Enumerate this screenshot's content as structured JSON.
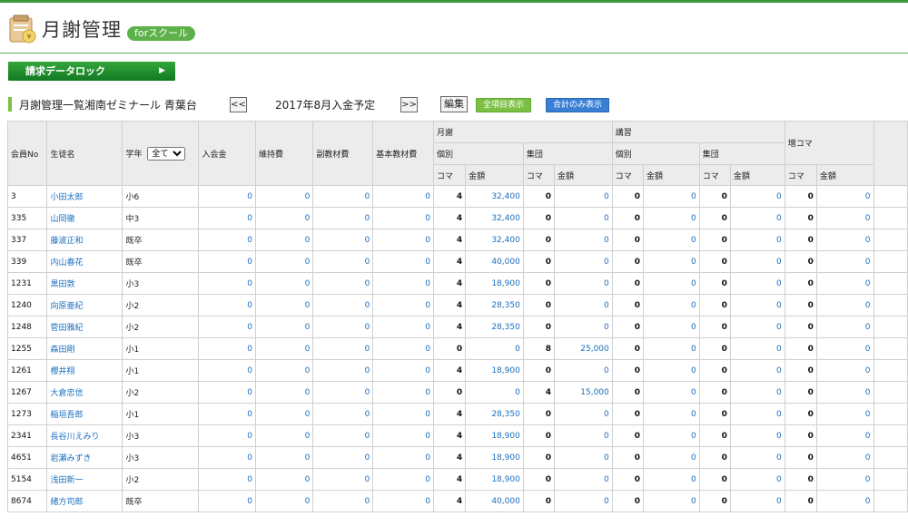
{
  "header": {
    "app_title": "月謝管理",
    "badge": "forスクール",
    "lock_button": "請求データロック",
    "lock_arrow": "▶"
  },
  "toolbar": {
    "title": "月謝管理一覧湘南ゼミナール 青葉台",
    "prev": "<<",
    "month": "2017年8月入金予定",
    "next": ">>",
    "edit": "編集",
    "show_all": "全項目表示",
    "show_total": "合計のみ表示"
  },
  "columns": {
    "member_no": "会員No",
    "name": "生徒名",
    "grade": "学年",
    "grade_select": "全て",
    "admission": "入会金",
    "maintenance": "維持費",
    "sub_material": "副教材費",
    "base_material": "基本教材費",
    "tuition": "月謝",
    "course": "講習",
    "extra": "増コマ",
    "individual": "個別",
    "group": "集団",
    "koma": "コマ",
    "amount": "金額"
  },
  "rows": [
    {
      "id": "3",
      "name": "小田太郎",
      "grade": "小6",
      "adm": "0",
      "mnt": "0",
      "sub": "0",
      "base": "0",
      "ik": "4",
      "ia": "32,400",
      "gk": "0",
      "ga": "0",
      "cik": "0",
      "cia": "0",
      "cgk": "0",
      "cga": "0",
      "ek": "0",
      "ea": "0"
    },
    {
      "id": "335",
      "name": "山岡徹",
      "grade": "中3",
      "adm": "0",
      "mnt": "0",
      "sub": "0",
      "base": "0",
      "ik": "4",
      "ia": "32,400",
      "gk": "0",
      "ga": "0",
      "cik": "0",
      "cia": "0",
      "cgk": "0",
      "cga": "0",
      "ek": "0",
      "ea": "0"
    },
    {
      "id": "337",
      "name": "藤波正和",
      "grade": "既卒",
      "adm": "0",
      "mnt": "0",
      "sub": "0",
      "base": "0",
      "ik": "4",
      "ia": "32,400",
      "gk": "0",
      "ga": "0",
      "cik": "0",
      "cia": "0",
      "cgk": "0",
      "cga": "0",
      "ek": "0",
      "ea": "0"
    },
    {
      "id": "339",
      "name": "内山春花",
      "grade": "既卒",
      "adm": "0",
      "mnt": "0",
      "sub": "0",
      "base": "0",
      "ik": "4",
      "ia": "40,000",
      "gk": "0",
      "ga": "0",
      "cik": "0",
      "cia": "0",
      "cgk": "0",
      "cga": "0",
      "ek": "0",
      "ea": "0"
    },
    {
      "id": "1231",
      "name": "黒田敦",
      "grade": "小3",
      "adm": "0",
      "mnt": "0",
      "sub": "0",
      "base": "0",
      "ik": "4",
      "ia": "18,900",
      "gk": "0",
      "ga": "0",
      "cik": "0",
      "cia": "0",
      "cgk": "0",
      "cga": "0",
      "ek": "0",
      "ea": "0"
    },
    {
      "id": "1240",
      "name": "向原亜紀",
      "grade": "小2",
      "adm": "0",
      "mnt": "0",
      "sub": "0",
      "base": "0",
      "ik": "4",
      "ia": "28,350",
      "gk": "0",
      "ga": "0",
      "cik": "0",
      "cia": "0",
      "cgk": "0",
      "cga": "0",
      "ek": "0",
      "ea": "0"
    },
    {
      "id": "1248",
      "name": "菅田雅紀",
      "grade": "小2",
      "adm": "0",
      "mnt": "0",
      "sub": "0",
      "base": "0",
      "ik": "4",
      "ia": "28,350",
      "gk": "0",
      "ga": "0",
      "cik": "0",
      "cia": "0",
      "cgk": "0",
      "cga": "0",
      "ek": "0",
      "ea": "0"
    },
    {
      "id": "1255",
      "name": "森田剛",
      "grade": "小1",
      "adm": "0",
      "mnt": "0",
      "sub": "0",
      "base": "0",
      "ik": "0",
      "ia": "0",
      "gk": "8",
      "ga": "25,000",
      "cik": "0",
      "cia": "0",
      "cgk": "0",
      "cga": "0",
      "ek": "0",
      "ea": "0"
    },
    {
      "id": "1261",
      "name": "櫻井翔",
      "grade": "小1",
      "adm": "0",
      "mnt": "0",
      "sub": "0",
      "base": "0",
      "ik": "4",
      "ia": "18,900",
      "gk": "0",
      "ga": "0",
      "cik": "0",
      "cia": "0",
      "cgk": "0",
      "cga": "0",
      "ek": "0",
      "ea": "0"
    },
    {
      "id": "1267",
      "name": "大倉忠信",
      "grade": "小2",
      "adm": "0",
      "mnt": "0",
      "sub": "0",
      "base": "0",
      "ik": "0",
      "ia": "0",
      "gk": "4",
      "ga": "15,000",
      "cik": "0",
      "cia": "0",
      "cgk": "0",
      "cga": "0",
      "ek": "0",
      "ea": "0"
    },
    {
      "id": "1273",
      "name": "稲垣吾郎",
      "grade": "小1",
      "adm": "0",
      "mnt": "0",
      "sub": "0",
      "base": "0",
      "ik": "4",
      "ia": "28,350",
      "gk": "0",
      "ga": "0",
      "cik": "0",
      "cia": "0",
      "cgk": "0",
      "cga": "0",
      "ek": "0",
      "ea": "0"
    },
    {
      "id": "2341",
      "name": "長谷川えみり",
      "grade": "小3",
      "adm": "0",
      "mnt": "0",
      "sub": "0",
      "base": "0",
      "ik": "4",
      "ia": "18,900",
      "gk": "0",
      "ga": "0",
      "cik": "0",
      "cia": "0",
      "cgk": "0",
      "cga": "0",
      "ek": "0",
      "ea": "0"
    },
    {
      "id": "4651",
      "name": "岩瀬みずき",
      "grade": "小3",
      "adm": "0",
      "mnt": "0",
      "sub": "0",
      "base": "0",
      "ik": "4",
      "ia": "18,900",
      "gk": "0",
      "ga": "0",
      "cik": "0",
      "cia": "0",
      "cgk": "0",
      "cga": "0",
      "ek": "0",
      "ea": "0"
    },
    {
      "id": "5154",
      "name": "浅田新一",
      "grade": "小2",
      "adm": "0",
      "mnt": "0",
      "sub": "0",
      "base": "0",
      "ik": "4",
      "ia": "18,900",
      "gk": "0",
      "ga": "0",
      "cik": "0",
      "cia": "0",
      "cgk": "0",
      "cga": "0",
      "ek": "0",
      "ea": "0"
    },
    {
      "id": "8674",
      "name": "緒方司郎",
      "grade": "既卒",
      "adm": "0",
      "mnt": "0",
      "sub": "0",
      "base": "0",
      "ik": "4",
      "ia": "40,000",
      "gk": "0",
      "ga": "0",
      "cik": "0",
      "cia": "0",
      "cgk": "0",
      "cga": "0",
      "ek": "0",
      "ea": "0"
    }
  ]
}
